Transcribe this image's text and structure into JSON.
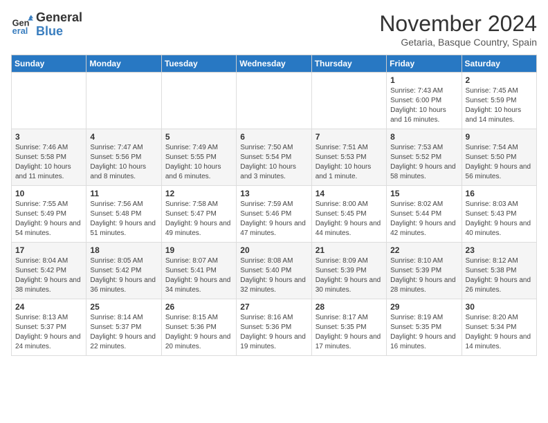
{
  "logo": {
    "line1": "General",
    "line2": "Blue"
  },
  "title": "November 2024",
  "subtitle": "Getaria, Basque Country, Spain",
  "days_of_week": [
    "Sunday",
    "Monday",
    "Tuesday",
    "Wednesday",
    "Thursday",
    "Friday",
    "Saturday"
  ],
  "weeks": [
    [
      {
        "day": "",
        "info": ""
      },
      {
        "day": "",
        "info": ""
      },
      {
        "day": "",
        "info": ""
      },
      {
        "day": "",
        "info": ""
      },
      {
        "day": "",
        "info": ""
      },
      {
        "day": "1",
        "info": "Sunrise: 7:43 AM\nSunset: 6:00 PM\nDaylight: 10 hours and 16 minutes."
      },
      {
        "day": "2",
        "info": "Sunrise: 7:45 AM\nSunset: 5:59 PM\nDaylight: 10 hours and 14 minutes."
      }
    ],
    [
      {
        "day": "3",
        "info": "Sunrise: 7:46 AM\nSunset: 5:58 PM\nDaylight: 10 hours and 11 minutes."
      },
      {
        "day": "4",
        "info": "Sunrise: 7:47 AM\nSunset: 5:56 PM\nDaylight: 10 hours and 8 minutes."
      },
      {
        "day": "5",
        "info": "Sunrise: 7:49 AM\nSunset: 5:55 PM\nDaylight: 10 hours and 6 minutes."
      },
      {
        "day": "6",
        "info": "Sunrise: 7:50 AM\nSunset: 5:54 PM\nDaylight: 10 hours and 3 minutes."
      },
      {
        "day": "7",
        "info": "Sunrise: 7:51 AM\nSunset: 5:53 PM\nDaylight: 10 hours and 1 minute."
      },
      {
        "day": "8",
        "info": "Sunrise: 7:53 AM\nSunset: 5:52 PM\nDaylight: 9 hours and 58 minutes."
      },
      {
        "day": "9",
        "info": "Sunrise: 7:54 AM\nSunset: 5:50 PM\nDaylight: 9 hours and 56 minutes."
      }
    ],
    [
      {
        "day": "10",
        "info": "Sunrise: 7:55 AM\nSunset: 5:49 PM\nDaylight: 9 hours and 54 minutes."
      },
      {
        "day": "11",
        "info": "Sunrise: 7:56 AM\nSunset: 5:48 PM\nDaylight: 9 hours and 51 minutes."
      },
      {
        "day": "12",
        "info": "Sunrise: 7:58 AM\nSunset: 5:47 PM\nDaylight: 9 hours and 49 minutes."
      },
      {
        "day": "13",
        "info": "Sunrise: 7:59 AM\nSunset: 5:46 PM\nDaylight: 9 hours and 47 minutes."
      },
      {
        "day": "14",
        "info": "Sunrise: 8:00 AM\nSunset: 5:45 PM\nDaylight: 9 hours and 44 minutes."
      },
      {
        "day": "15",
        "info": "Sunrise: 8:02 AM\nSunset: 5:44 PM\nDaylight: 9 hours and 42 minutes."
      },
      {
        "day": "16",
        "info": "Sunrise: 8:03 AM\nSunset: 5:43 PM\nDaylight: 9 hours and 40 minutes."
      }
    ],
    [
      {
        "day": "17",
        "info": "Sunrise: 8:04 AM\nSunset: 5:42 PM\nDaylight: 9 hours and 38 minutes."
      },
      {
        "day": "18",
        "info": "Sunrise: 8:05 AM\nSunset: 5:42 PM\nDaylight: 9 hours and 36 minutes."
      },
      {
        "day": "19",
        "info": "Sunrise: 8:07 AM\nSunset: 5:41 PM\nDaylight: 9 hours and 34 minutes."
      },
      {
        "day": "20",
        "info": "Sunrise: 8:08 AM\nSunset: 5:40 PM\nDaylight: 9 hours and 32 minutes."
      },
      {
        "day": "21",
        "info": "Sunrise: 8:09 AM\nSunset: 5:39 PM\nDaylight: 9 hours and 30 minutes."
      },
      {
        "day": "22",
        "info": "Sunrise: 8:10 AM\nSunset: 5:39 PM\nDaylight: 9 hours and 28 minutes."
      },
      {
        "day": "23",
        "info": "Sunrise: 8:12 AM\nSunset: 5:38 PM\nDaylight: 9 hours and 26 minutes."
      }
    ],
    [
      {
        "day": "24",
        "info": "Sunrise: 8:13 AM\nSunset: 5:37 PM\nDaylight: 9 hours and 24 minutes."
      },
      {
        "day": "25",
        "info": "Sunrise: 8:14 AM\nSunset: 5:37 PM\nDaylight: 9 hours and 22 minutes."
      },
      {
        "day": "26",
        "info": "Sunrise: 8:15 AM\nSunset: 5:36 PM\nDaylight: 9 hours and 20 minutes."
      },
      {
        "day": "27",
        "info": "Sunrise: 8:16 AM\nSunset: 5:36 PM\nDaylight: 9 hours and 19 minutes."
      },
      {
        "day": "28",
        "info": "Sunrise: 8:17 AM\nSunset: 5:35 PM\nDaylight: 9 hours and 17 minutes."
      },
      {
        "day": "29",
        "info": "Sunrise: 8:19 AM\nSunset: 5:35 PM\nDaylight: 9 hours and 16 minutes."
      },
      {
        "day": "30",
        "info": "Sunrise: 8:20 AM\nSunset: 5:34 PM\nDaylight: 9 hours and 14 minutes."
      }
    ]
  ]
}
